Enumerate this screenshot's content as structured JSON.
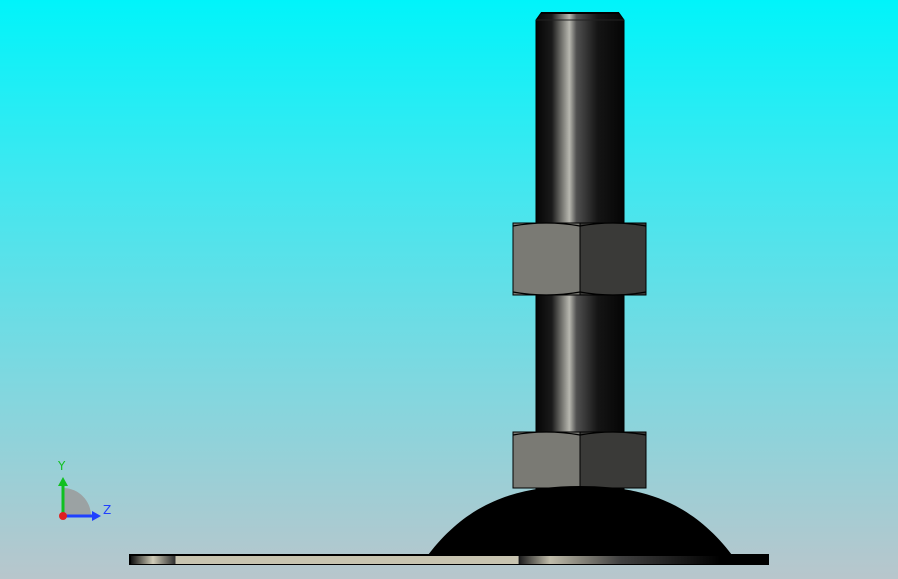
{
  "viewport": {
    "background_top": "#00f4fa",
    "background_bottom": "#b8c6cc"
  },
  "triad": {
    "y_label": "Y",
    "z_label": "Z",
    "y_color": "#10c020",
    "z_color": "#2040ff",
    "origin_color": "#e02020"
  },
  "model": {
    "parts": [
      "threaded-rod",
      "upper-hex-nut",
      "lower-hex-nut",
      "dome-base",
      "base-plate"
    ],
    "rod_color": "#101010",
    "nut_light_face": "#7a7a74",
    "nut_dark_face": "#3a3a38",
    "base_color": "#000000",
    "plate_light": "#c8c4b0"
  }
}
